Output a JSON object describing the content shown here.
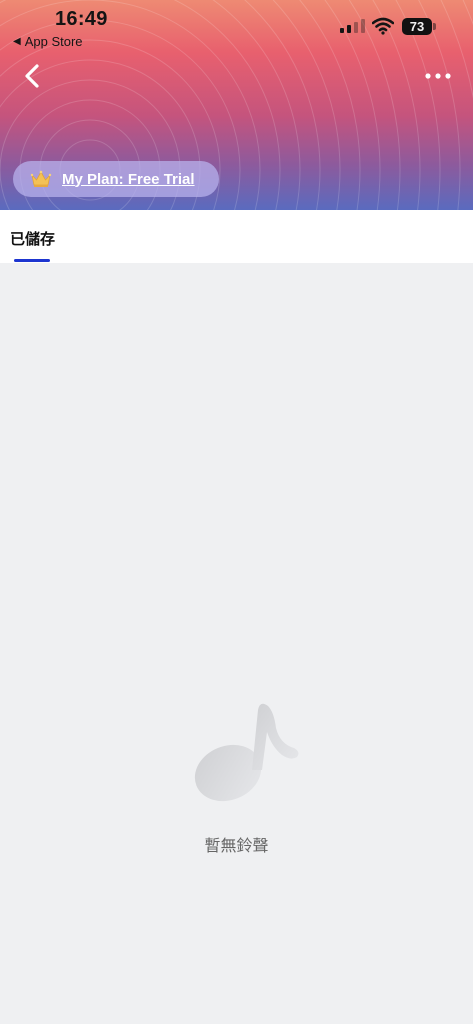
{
  "status_bar": {
    "time": "16:49",
    "back_app": "App Store",
    "battery": "73"
  },
  "header": {
    "plan_label": "My Plan: Free Trial"
  },
  "tabs": [
    {
      "label": "已儲存",
      "active": true
    }
  ],
  "empty_state": {
    "message": "暫無鈴聲",
    "icon": "music-note-icon"
  },
  "colors": {
    "accent": "#1d35d0",
    "page_background": "#eff0f2"
  }
}
